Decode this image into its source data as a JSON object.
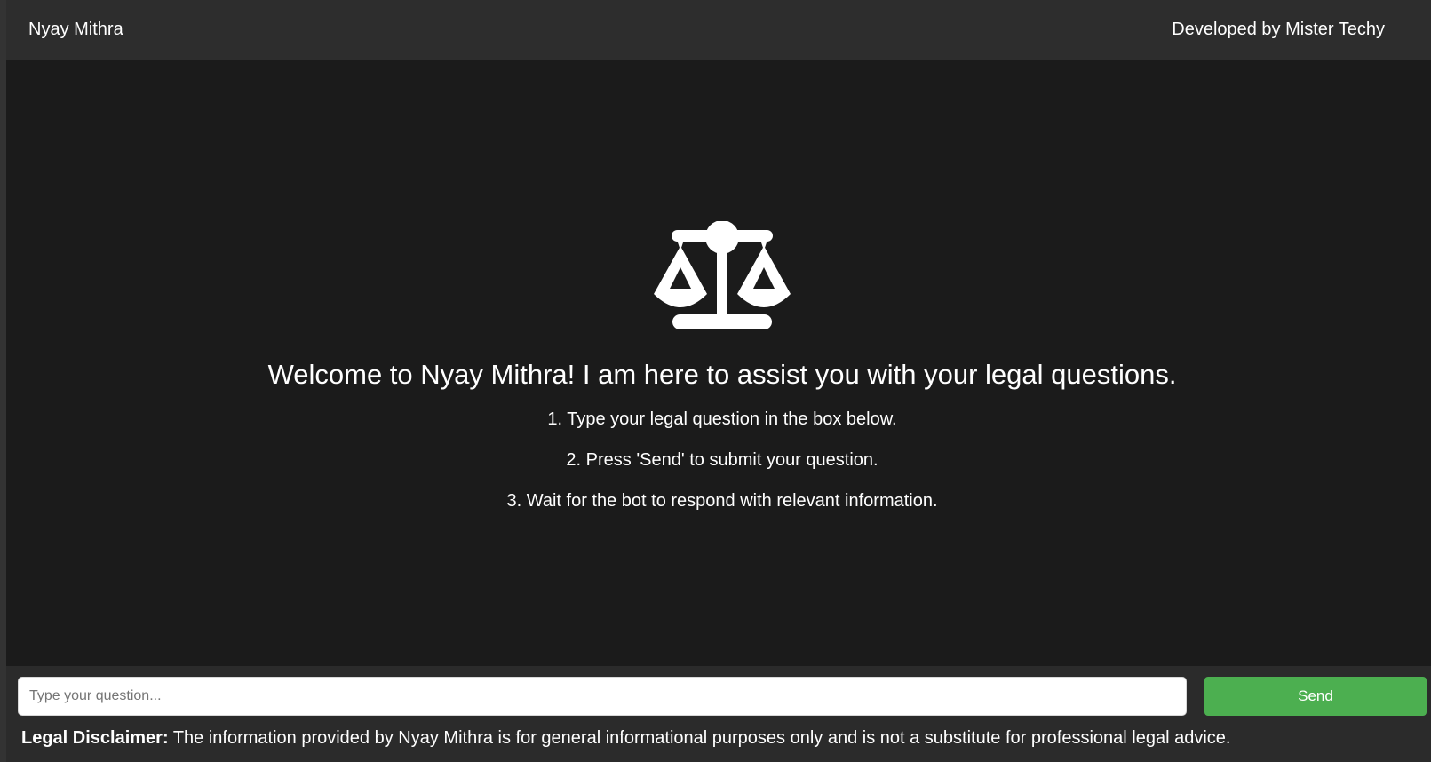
{
  "header": {
    "brand": "Nyay Mithra",
    "credit": "Developed by Mister Techy"
  },
  "welcome": {
    "icon": "balance-scale-icon",
    "title": "Welcome to Nyay Mithra! I am here to assist you with your legal questions.",
    "steps": [
      "1. Type your legal question in the box below.",
      "2. Press 'Send' to submit your question.",
      "3. Wait for the bot to respond with relevant information."
    ]
  },
  "input": {
    "placeholder": "Type your question...",
    "value": ""
  },
  "send_label": "Send",
  "disclaimer": {
    "label": "Legal Disclaimer:",
    "text": " The information provided by Nyay Mithra is for general informational purposes only and is not a substitute for professional legal advice."
  },
  "colors": {
    "header_bg": "#2d2d2d",
    "chat_bg": "#1b1b1b",
    "footer_bg": "#2b2b2b",
    "send_button": "#4caf50",
    "text": "#ffffff"
  }
}
